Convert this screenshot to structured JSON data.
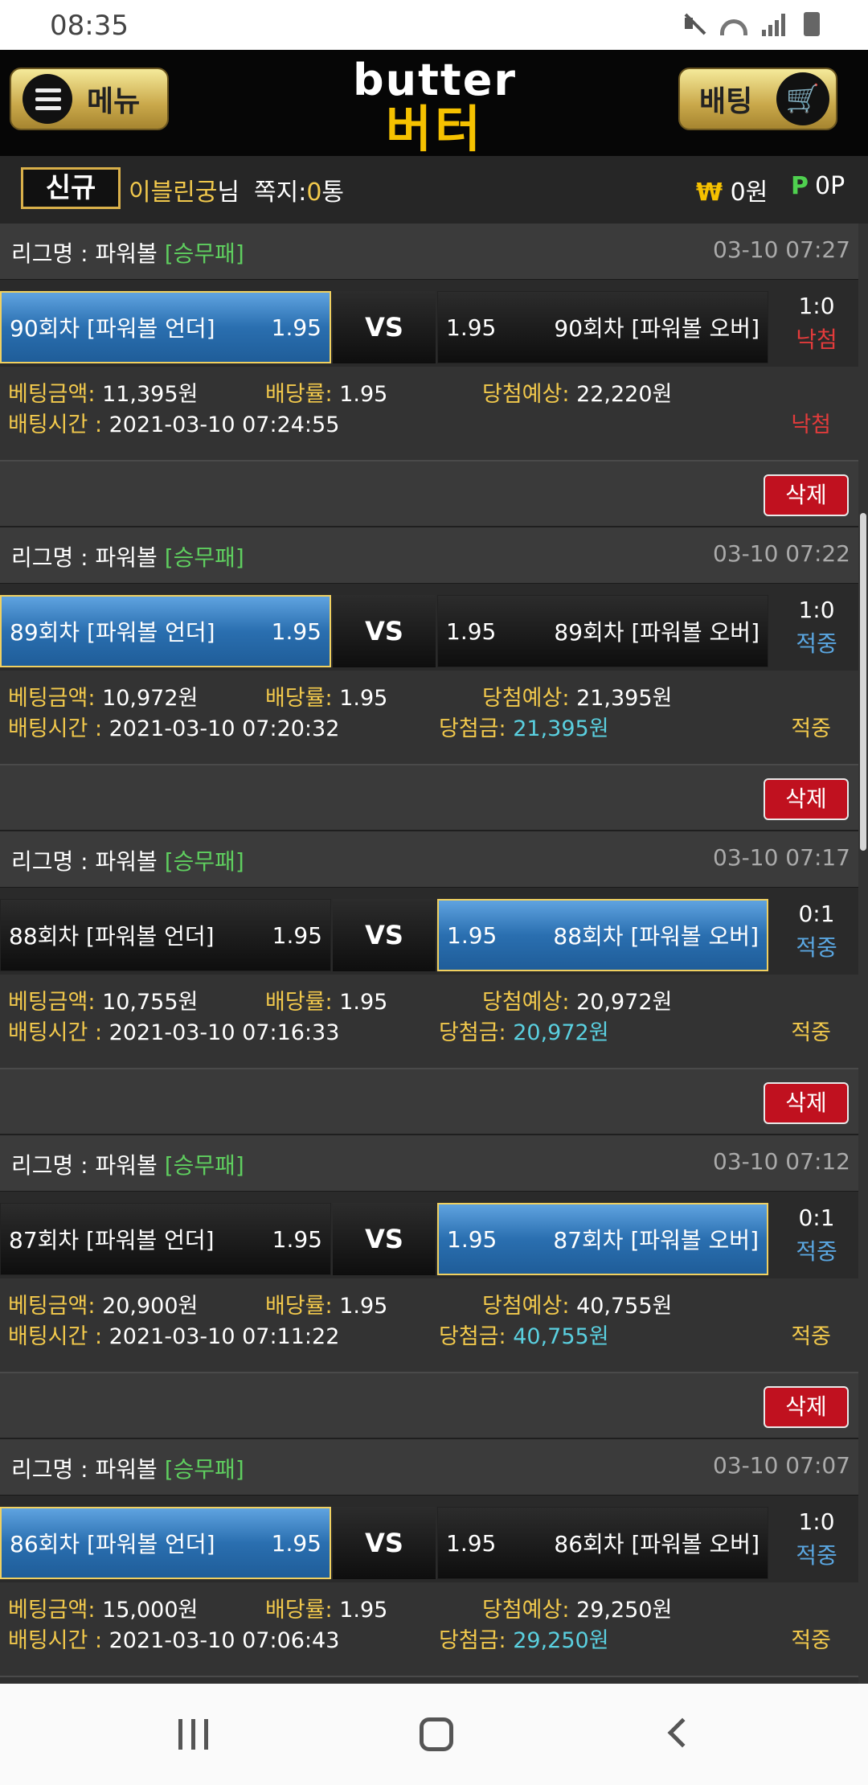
{
  "status_bar": {
    "time": "08:35"
  },
  "header": {
    "menu_label": "메뉴",
    "bet_label": "배팅",
    "logo_en": "butter",
    "logo_ko": "버터"
  },
  "user": {
    "badge": "신규",
    "name": "이블린궁",
    "name_suffix": "님",
    "messages_label": "쪽지:",
    "messages_count": "0",
    "messages_unit": "통",
    "currency_icon": "₩",
    "money": "0원",
    "points_icon": "P",
    "points": "0P"
  },
  "labels": {
    "league_prefix": "리그명 : ",
    "vs": "VS",
    "amount": "베팅금액:",
    "odds": "배당률:",
    "expected": "당첨예상:",
    "bet_time": "배팅시간 : ",
    "won": "당첨금:",
    "delete": "삭제"
  },
  "bets": [
    {
      "league": "파워볼",
      "type": "[승무패]",
      "date": "03-10 07:27",
      "home": "90회차 [파워볼 언더]",
      "home_odds": "1.95",
      "away": "90회차 [파워볼 오버]",
      "away_odds": "1.95",
      "selected": "home",
      "score": "1:0",
      "result": "낙첨",
      "amount": "11,395원",
      "odds": "1.95",
      "expected": "22,220원",
      "time": "2021-03-10 07:24:55",
      "won": "",
      "status": "낙첨"
    },
    {
      "league": "파워볼",
      "type": "[승무패]",
      "date": "03-10 07:22",
      "home": "89회차 [파워볼 언더]",
      "home_odds": "1.95",
      "away": "89회차 [파워볼 오버]",
      "away_odds": "1.95",
      "selected": "home",
      "score": "1:0",
      "result": "적중",
      "amount": "10,972원",
      "odds": "1.95",
      "expected": "21,395원",
      "time": "2021-03-10 07:20:32",
      "won": "21,395원",
      "status": "적중"
    },
    {
      "league": "파워볼",
      "type": "[승무패]",
      "date": "03-10 07:17",
      "home": "88회차 [파워볼 언더]",
      "home_odds": "1.95",
      "away": "88회차 [파워볼 오버]",
      "away_odds": "1.95",
      "selected": "away",
      "score": "0:1",
      "result": "적중",
      "amount": "10,755원",
      "odds": "1.95",
      "expected": "20,972원",
      "time": "2021-03-10 07:16:33",
      "won": "20,972원",
      "status": "적중"
    },
    {
      "league": "파워볼",
      "type": "[승무패]",
      "date": "03-10 07:12",
      "home": "87회차 [파워볼 언더]",
      "home_odds": "1.95",
      "away": "87회차 [파워볼 오버]",
      "away_odds": "1.95",
      "selected": "away",
      "score": "0:1",
      "result": "적중",
      "amount": "20,900원",
      "odds": "1.95",
      "expected": "40,755원",
      "time": "2021-03-10 07:11:22",
      "won": "40,755원",
      "status": "적중"
    },
    {
      "league": "파워볼",
      "type": "[승무패]",
      "date": "03-10 07:07",
      "home": "86회차 [파워볼 언더]",
      "home_odds": "1.95",
      "away": "86회차 [파워볼 오버]",
      "away_odds": "1.95",
      "selected": "home",
      "score": "1:0",
      "result": "적중",
      "amount": "15,000원",
      "odds": "1.95",
      "expected": "29,250원",
      "time": "2021-03-10 07:06:43",
      "won": "29,250원",
      "status": "적중"
    }
  ],
  "colors": {
    "accent_gold": "#f2c94c",
    "lose_red": "#e23b3b",
    "win_blue": "#5aa6e0",
    "selected_blue": "#2a6fb0",
    "type_green": "#5fcf5f"
  }
}
